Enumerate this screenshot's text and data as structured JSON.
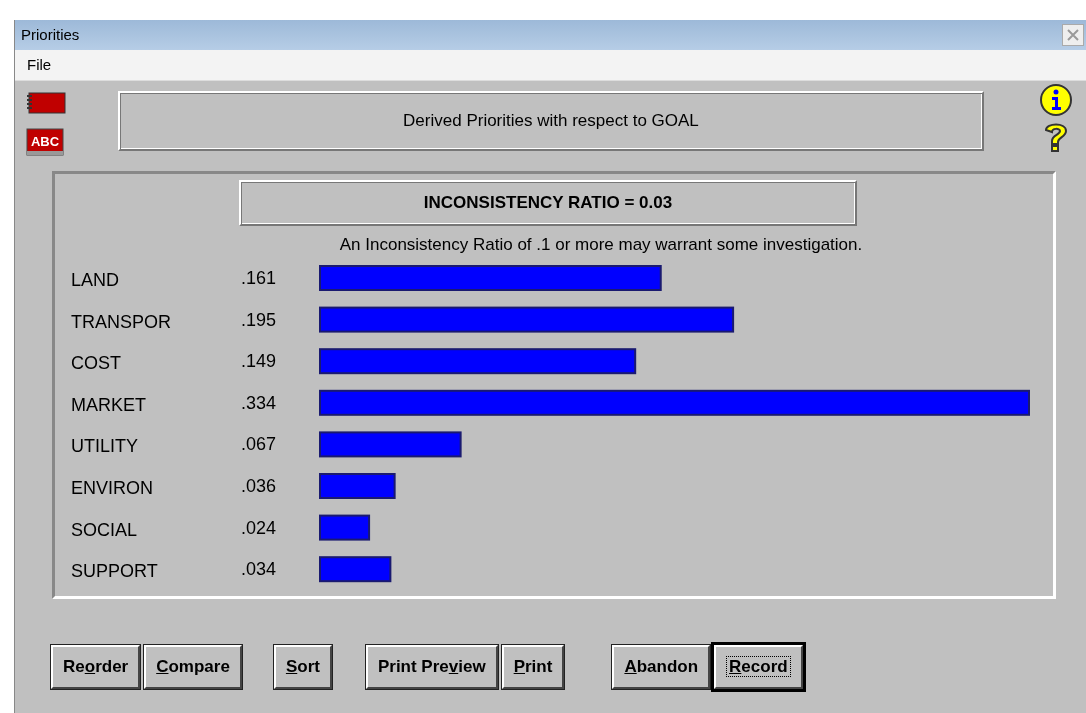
{
  "window": {
    "title": "Priorities"
  },
  "menu": [
    "File"
  ],
  "dictionary_icon_text": "ABC",
  "header": "Derived Priorities with respect to GOAL",
  "inconsistency": "INCONSISTENCY RATIO = 0.03",
  "note": "An Inconsistency Ratio of .1 or more may warrant some investigation.",
  "chart_data": {
    "type": "bar",
    "orientation": "horizontal",
    "categories": [
      "LAND",
      "TRANSPOR",
      "COST",
      "MARKET",
      "UTILITY",
      "ENVIRON",
      "SOCIAL",
      "SUPPORT"
    ],
    "values": [
      0.161,
      0.195,
      0.149,
      0.334,
      0.067,
      0.036,
      0.024,
      0.034
    ],
    "value_labels": [
      ".161",
      ".195",
      ".149",
      ".334",
      ".067",
      ".036",
      ".024",
      ".034"
    ],
    "xlim": [
      0,
      0.334
    ]
  },
  "button_groups": [
    [
      {
        "before": "Re",
        "key": "o",
        "after": "rder",
        "default": false
      },
      {
        "key": "C",
        "after": "ompare",
        "default": false
      }
    ],
    [
      {
        "key": "S",
        "after": "ort",
        "default": false
      }
    ],
    [
      {
        "before": "Print Pre",
        "key": "v",
        "after": "iew",
        "default": false
      },
      {
        "key": "P",
        "after": "rint",
        "default": false
      }
    ],
    [
      {
        "key": "A",
        "after": "bandon",
        "default": false
      },
      {
        "key": "R",
        "after": "ecord",
        "default": true
      }
    ]
  ]
}
